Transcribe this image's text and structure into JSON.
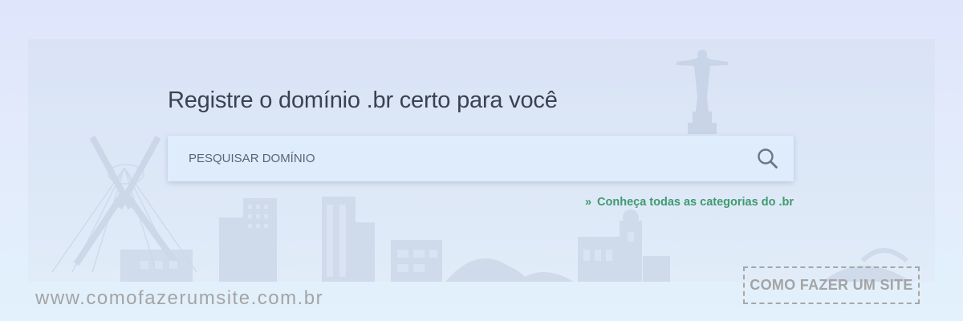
{
  "hero": {
    "title": "Registre o domínio .br certo para você"
  },
  "search": {
    "placeholder": "PESQUISAR DOMÍNIO",
    "value": "",
    "button_icon": "search-icon"
  },
  "categories_link": {
    "arrows": "»",
    "label": "Conheça todas as categorias do .br",
    "color": "#3e9a70"
  },
  "watermark": {
    "url": "www.comofazerumsite.com.br",
    "badge": "COMO FAZER UM SITE"
  },
  "colors": {
    "background": "#dfe5fb",
    "panel": "#d9e3f5",
    "search_box": "#dfecfb",
    "title_text": "#3a4250"
  }
}
